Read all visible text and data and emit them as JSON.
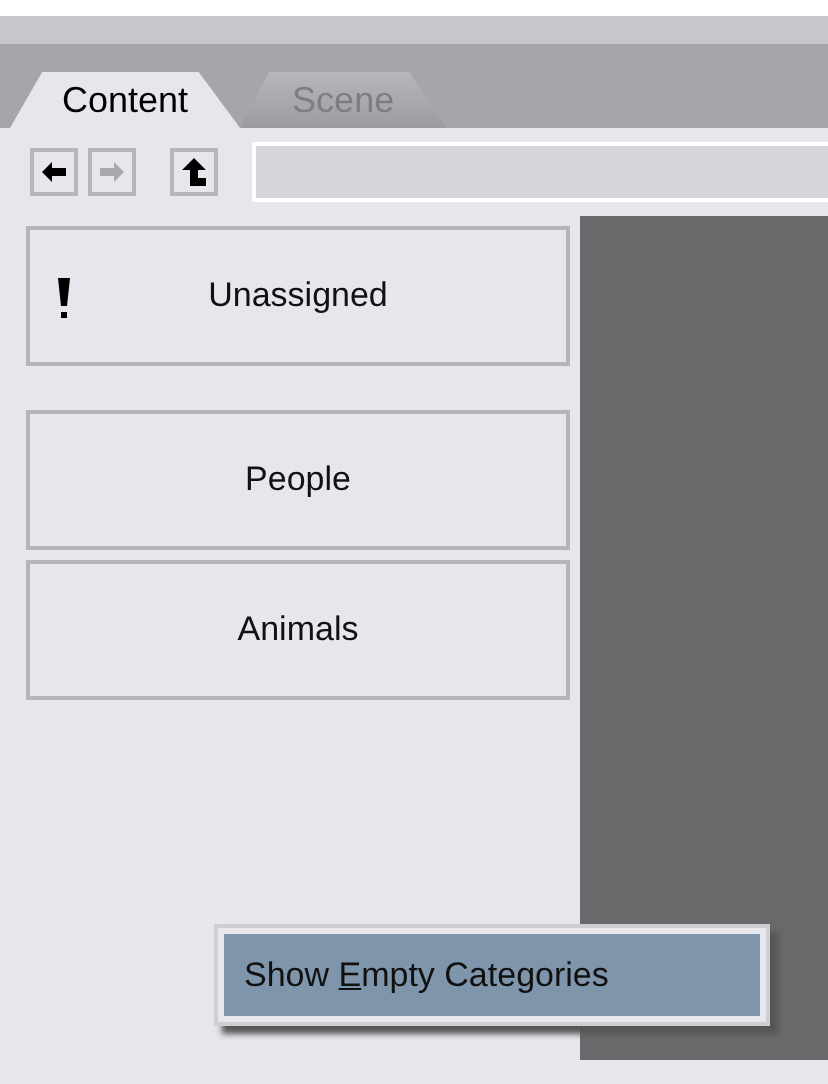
{
  "tabs": [
    {
      "label": "Content",
      "selected": true
    },
    {
      "label": "Scene",
      "selected": false
    }
  ],
  "nav_buttons": [
    {
      "kind": "back",
      "disabled": false
    },
    {
      "kind": "forward",
      "disabled": true
    },
    {
      "kind": "up",
      "disabled": false
    }
  ],
  "categories": [
    {
      "label": "Unassigned",
      "kind": "warning"
    },
    {
      "label": "People",
      "kind": "plain"
    },
    {
      "label": "Animals",
      "kind": "plain"
    }
  ],
  "context_menu": {
    "items": [
      {
        "before": "Show ",
        "mnemonic": "E",
        "after": "mpty Categories",
        "selected": true
      }
    ]
  }
}
